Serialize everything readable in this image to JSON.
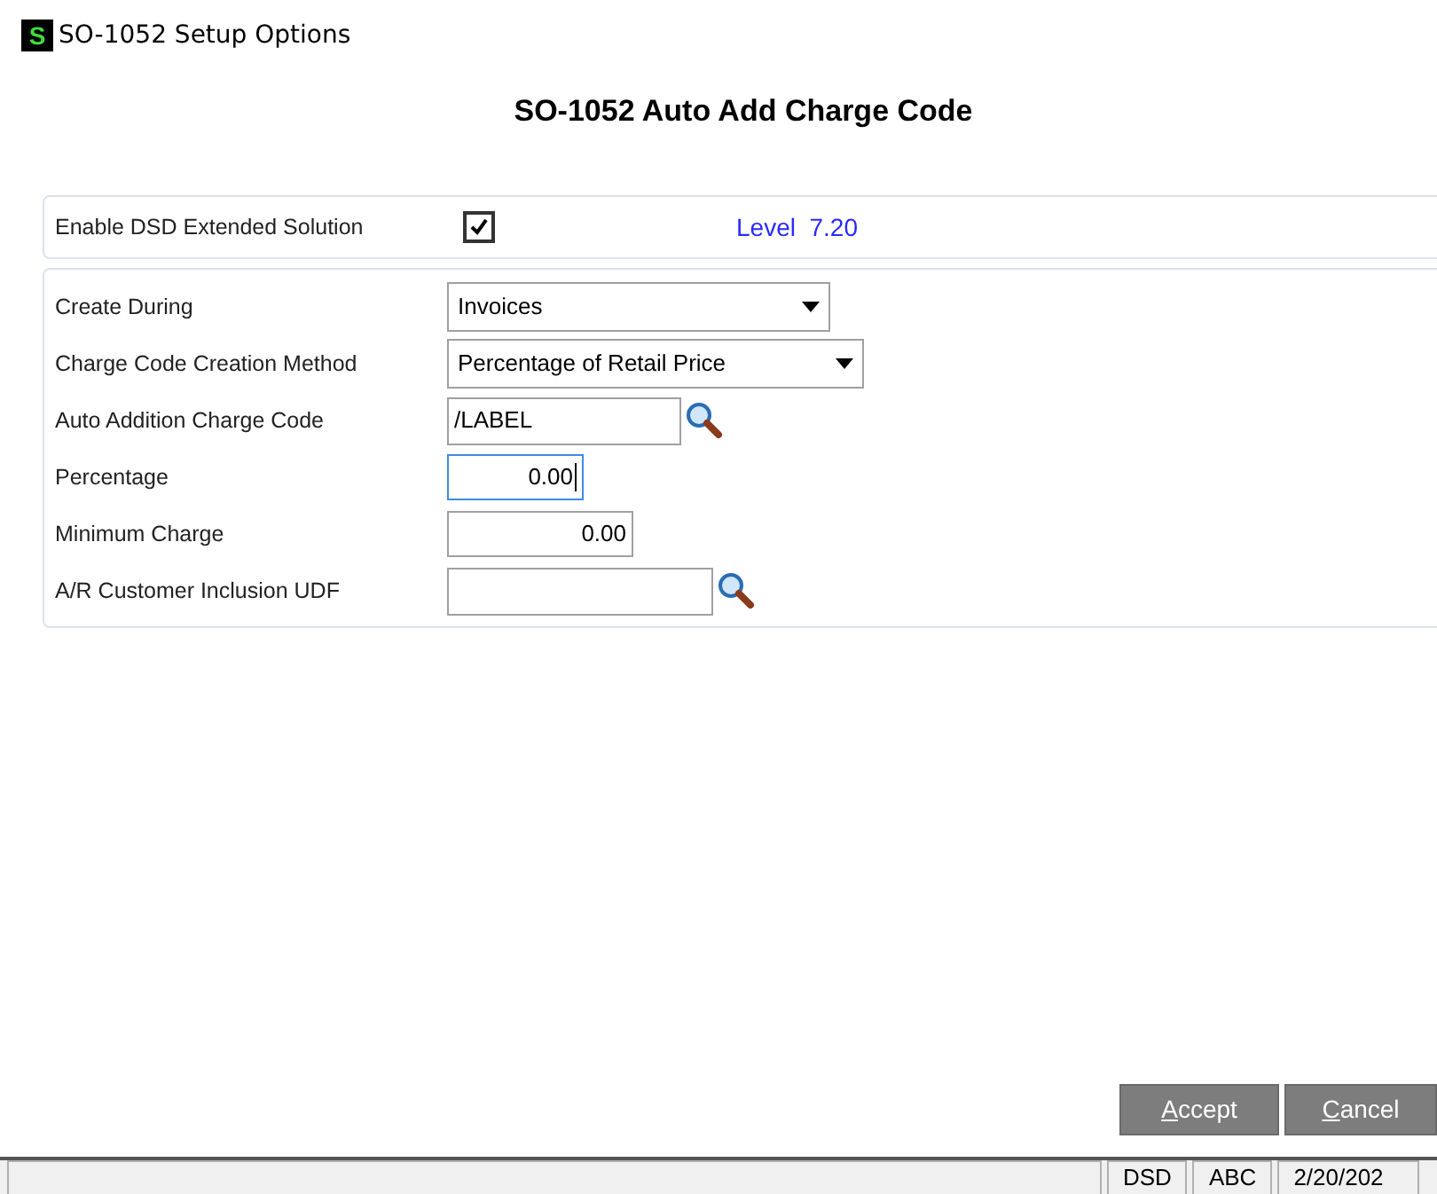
{
  "window": {
    "title": "SO-1052 Setup Options",
    "icon_letter": "S"
  },
  "heading": "SO-1052 Auto Add Charge Code",
  "enable": {
    "label": "Enable DSD Extended Solution",
    "checked": true,
    "level_text": "Level  7.20"
  },
  "fields": [
    {
      "kind": "select",
      "label": "Create During",
      "value": "Invoices",
      "focused": false
    },
    {
      "kind": "select",
      "label": "Charge Code Creation Method",
      "value": "Percentage of Retail Price",
      "focused": false
    },
    {
      "kind": "lookup",
      "label": "Auto Addition Charge Code",
      "value": "/LABEL",
      "focused": false
    },
    {
      "kind": "number",
      "label": "Percentage",
      "value": "0.00",
      "focused": true
    },
    {
      "kind": "number",
      "label": "Minimum Charge",
      "value": "0.00",
      "focused": false
    },
    {
      "kind": "lookup",
      "label": "A/R Customer Inclusion UDF",
      "focused": false
    }
  ],
  "buttons": [
    {
      "label": "Accept"
    },
    {
      "label": "Cancel"
    }
  ],
  "status_bar": [
    "DSD",
    "ABC",
    "2/20/202"
  ]
}
